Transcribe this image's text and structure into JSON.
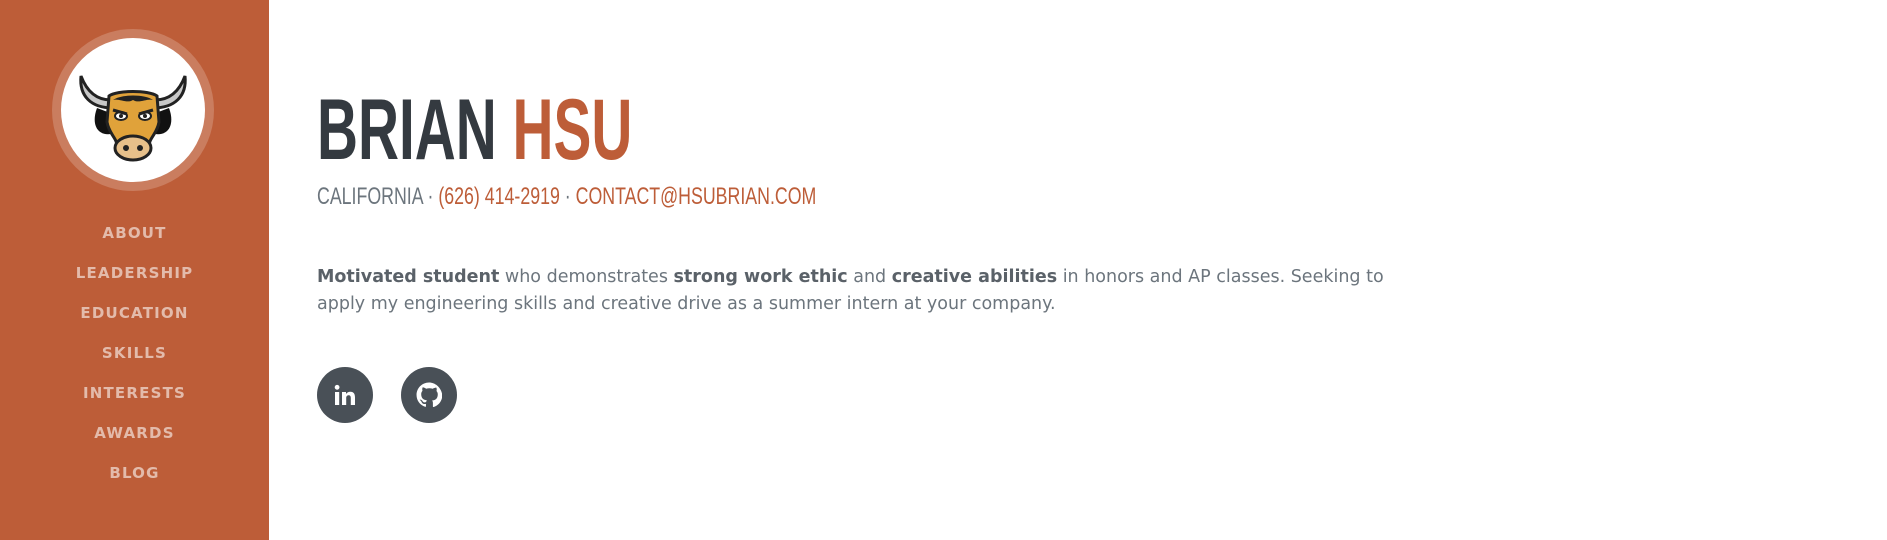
{
  "nav": {
    "items": [
      {
        "label": "ABOUT"
      },
      {
        "label": "LEADERSHIP"
      },
      {
        "label": "EDUCATION"
      },
      {
        "label": "SKILLS"
      },
      {
        "label": "INTERESTS"
      },
      {
        "label": "AWARDS"
      },
      {
        "label": "BLOG"
      }
    ]
  },
  "header": {
    "first_name": "BRIAN",
    "last_name": "HSU",
    "location": "CALIFORNIA",
    "separator": " · ",
    "phone": "(626) 414-2919",
    "email": "CONTACT@HSUBRIAN.COM"
  },
  "intro": {
    "p1_bold": "Motivated student",
    "p2": " who demonstrates ",
    "p3_bold": "strong work ethic",
    "p4": " and ",
    "p5_bold": "creative abilities",
    "p6": " in honors and AP classes. Seeking to apply my engineering skills and creative drive as a summer intern at your company."
  },
  "social": [
    {
      "icon": "linkedin-icon"
    },
    {
      "icon": "github-icon"
    }
  ],
  "colors": {
    "accent": "#bd5d38",
    "heading": "#343a40",
    "text": "#6c757d",
    "social_bg": "#495057"
  }
}
